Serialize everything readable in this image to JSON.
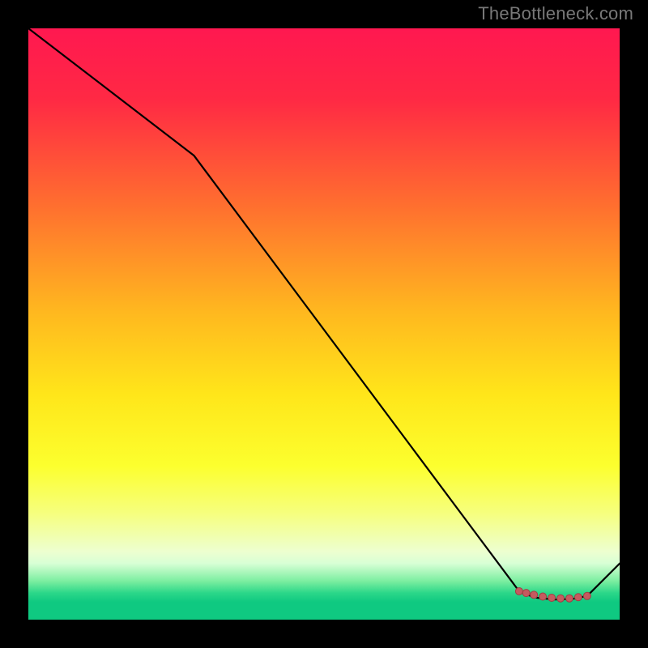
{
  "watermark": "TheBottleneck.com",
  "chart_data": {
    "type": "line",
    "title": "",
    "xlabel": "",
    "ylabel": "",
    "xlim": [
      0,
      100
    ],
    "ylim": [
      0,
      100
    ],
    "grid": false,
    "background_gradient": {
      "stops": [
        {
          "offset": 0.0,
          "color": "#ff1850"
        },
        {
          "offset": 0.12,
          "color": "#ff2944"
        },
        {
          "offset": 0.3,
          "color": "#ff6f2f"
        },
        {
          "offset": 0.48,
          "color": "#ffb81f"
        },
        {
          "offset": 0.62,
          "color": "#ffe61a"
        },
        {
          "offset": 0.74,
          "color": "#fcff2e"
        },
        {
          "offset": 0.82,
          "color": "#f6ff7e"
        },
        {
          "offset": 0.885,
          "color": "#edffd0"
        },
        {
          "offset": 0.905,
          "color": "#d8ffd5"
        },
        {
          "offset": 0.935,
          "color": "#7beea0"
        },
        {
          "offset": 0.955,
          "color": "#2bd789"
        },
        {
          "offset": 0.97,
          "color": "#0fc981"
        },
        {
          "offset": 1.0,
          "color": "#0fc981"
        }
      ]
    },
    "series": [
      {
        "name": "bottleneck-curve",
        "color": "#000000",
        "stroke_width": 2.2,
        "x": [
          0.0,
          28.0,
          83.0,
          84.0,
          86.0,
          89.0,
          92.0,
          94.5,
          100.0
        ],
        "y": [
          100.0,
          78.5,
          4.8,
          4.3,
          3.7,
          3.4,
          3.5,
          4.0,
          9.5
        ]
      }
    ],
    "markers": {
      "name": "highlight-band",
      "color": "#c55a5f",
      "radius": 4.5,
      "stroke": "#a23e44",
      "x": [
        83.0,
        84.2,
        85.5,
        87.0,
        88.5,
        90.0,
        91.5,
        93.0,
        94.5
      ],
      "y": [
        4.8,
        4.5,
        4.2,
        3.9,
        3.7,
        3.6,
        3.6,
        3.8,
        4.0
      ]
    }
  }
}
